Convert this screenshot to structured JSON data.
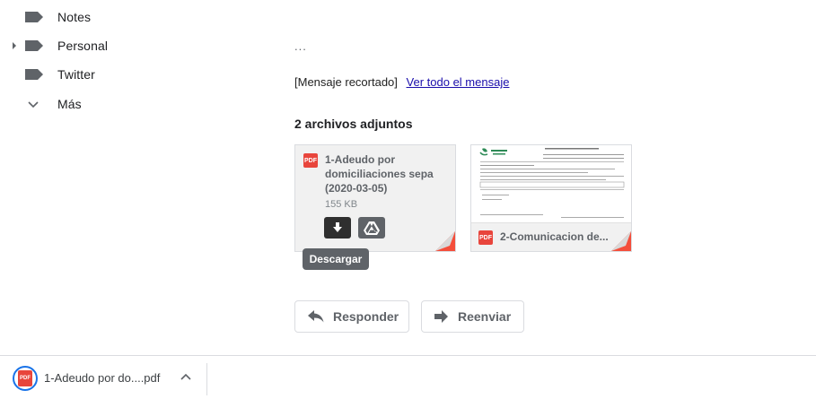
{
  "sidebar": {
    "items": [
      {
        "label": "Notes",
        "icon": "label-icon",
        "expandable": false
      },
      {
        "label": "Personal",
        "icon": "label-icon",
        "expandable": true
      },
      {
        "label": "Twitter",
        "icon": "label-icon",
        "expandable": false
      }
    ],
    "more_label": "Más"
  },
  "message": {
    "ellipsis": "...",
    "clipped_text": "[Mensaje recortado]",
    "view_full_link": "Ver todo el mensaje"
  },
  "attachments": {
    "title": "2 archivos adjuntos",
    "items": [
      {
        "name": "1-Adeudo por domiciliaciones sepa (2020-03-05)",
        "size": "155 KB",
        "type": "PDF"
      },
      {
        "name": "2-Comunicacion de...",
        "type": "PDF"
      }
    ],
    "tooltip": "Descargar"
  },
  "actions": {
    "reply_label": "Responder",
    "forward_label": "Reenviar"
  },
  "download_bar": {
    "file_name": "1-Adeudo por do....pdf"
  },
  "colors": {
    "pdf_red": "#e8453c",
    "link_blue": "#1a0dab",
    "download_ring": "#1a73e8"
  }
}
